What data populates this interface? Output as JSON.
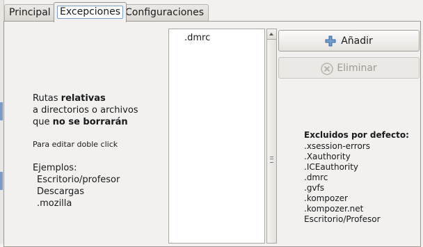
{
  "tabs": [
    {
      "label": "Principal",
      "active": false
    },
    {
      "label": "Excepciones",
      "active": true
    },
    {
      "label": "Configuraciones",
      "active": false
    }
  ],
  "info": {
    "line1_pre": "Rutas ",
    "line1_bold": "relativas",
    "line2": "a directorios o archivos",
    "line3_pre": "que ",
    "line3_bold": "no se borrarán",
    "hint": "Para editar doble click",
    "examples_title": "Ejemplos:",
    "examples": [
      "Escritorio/profesor",
      "Descargas",
      ".mozilla"
    ]
  },
  "exceptions_list": {
    "items": [
      ".dmrc"
    ]
  },
  "buttons": {
    "add_label": "Añadir",
    "remove_label": "Eliminar",
    "remove_enabled": false
  },
  "defaults": {
    "title": "Excluidos por defecto:",
    "items": [
      ".xsession-errors",
      ".Xauthority",
      ".ICEauthority",
      ".dmrc",
      ".gvfs",
      ".kompozer",
      ".kompozer.net",
      "Escritorio/Profesor"
    ]
  },
  "colors": {
    "add_icon": "#3465a4",
    "disabled_text": "#9d9a95"
  }
}
